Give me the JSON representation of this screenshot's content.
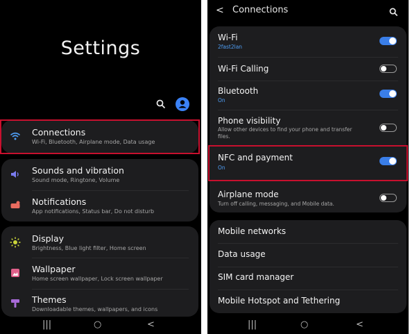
{
  "left": {
    "title": "Settings",
    "search_icon": "search-icon",
    "avatar_icon": "account-icon",
    "items": [
      {
        "label": "Connections",
        "sub": "Wi-Fi, Bluetooth, Airplane mode, Data usage",
        "icon": "wifi-icon",
        "icon_color": "#4f9ff6"
      },
      {
        "label": "Sounds and vibration",
        "sub": "Sound mode, Ringtone, Volume",
        "icon": "speaker-icon",
        "icon_color": "#7a7cf0"
      },
      {
        "label": "Notifications",
        "sub": "App notifications, Status bar, Do not disturb",
        "icon": "notification-icon",
        "icon_color": "#e86b5f"
      },
      {
        "label": "Display",
        "sub": "Brightness, Blue light filter, Home screen",
        "icon": "brightness-icon",
        "icon_color": "#c9d43a"
      },
      {
        "label": "Wallpaper",
        "sub": "Home screen wallpaper, Lock screen wallpaper",
        "icon": "wallpaper-icon",
        "icon_color": "#e0608a"
      },
      {
        "label": "Themes",
        "sub": "Downloadable themes, wallpapers, and icons",
        "icon": "themes-icon",
        "icon_color": "#a86ad8"
      }
    ],
    "nav": {
      "recents": "|||",
      "home": "○",
      "back": "<"
    }
  },
  "right": {
    "back_icon": "<",
    "title": "Connections",
    "search_icon": "search-icon",
    "items": [
      {
        "label": "Wi-Fi",
        "sub": "2fast2lan",
        "toggle": "on"
      },
      {
        "label": "Wi-Fi Calling",
        "sub": "",
        "toggle": "off"
      },
      {
        "label": "Bluetooth",
        "sub": "On",
        "toggle": "on"
      },
      {
        "label": "Phone visibility",
        "sub": "Allow other devices to find your phone and transfer files.",
        "toggle": "off"
      },
      {
        "label": "NFC and payment",
        "sub": "On",
        "toggle": "on"
      },
      {
        "label": "Airplane mode",
        "sub": "Turn off calling, messaging, and Mobile data.",
        "toggle": "off"
      },
      {
        "label": "Mobile networks"
      },
      {
        "label": "Data usage"
      },
      {
        "label": "SIM card manager"
      },
      {
        "label": "Mobile Hotspot and Tethering"
      }
    ],
    "nav": {
      "recents": "|||",
      "home": "○",
      "back": "<"
    }
  },
  "colors": {
    "accent": "#3a7ee8",
    "highlight": "#c8102e",
    "card": "#1d1d1f"
  }
}
